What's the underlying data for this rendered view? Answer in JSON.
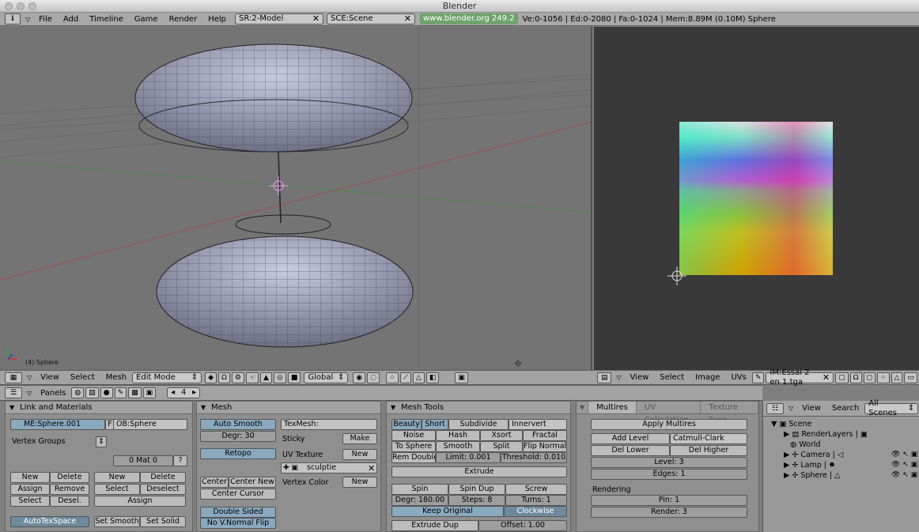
{
  "window": {
    "title": "Blender"
  },
  "topbar": {
    "menus": [
      "File",
      "Add",
      "Timeline",
      "Game",
      "Render",
      "Help"
    ],
    "screen": "SR:2-Model",
    "scene": "SCE:Scene",
    "url": "www.blender.org 249.2",
    "stats": "Ve:0-1056 | Ed:0-2080 | Fa:0-1024 | Mem:8.89M (0.10M) Sphere"
  },
  "viewport3d": {
    "object_label": "(4) Sphere",
    "menus": [
      "View",
      "Select",
      "Mesh"
    ],
    "mode": "Edit Mode",
    "orientation": "Global"
  },
  "image_editor": {
    "menus": [
      "View",
      "Select",
      "Image",
      "UVs"
    ],
    "image_name": "IM:Essai 2 en 1.tga"
  },
  "buttons_header": {
    "label": "Panels",
    "frame": "4"
  },
  "link_materials": {
    "title": "Link and Materials",
    "mesh_name": "ME:Sphere.001",
    "f": "F",
    "object_name": "OB:Sphere",
    "vertex_groups": "Vertex Groups",
    "mat": "0 Mat 0",
    "q": "?",
    "new": "New",
    "delete": "Delete",
    "assign": "Assign",
    "remove": "Remove",
    "select": "Select",
    "desel": "Desel.",
    "new2": "New",
    "delete2": "Delete",
    "select2": "Select",
    "deselect": "Deselect",
    "assign2": "Assign",
    "autotexspace": "AutoTexSpace",
    "set_smooth": "Set Smooth",
    "set_solid": "Set Solid"
  },
  "mesh": {
    "title": "Mesh",
    "auto_smooth": "Auto Smooth",
    "degr": "Degr: 30",
    "retopo": "Retopo",
    "center": "Center",
    "center_new": "Center New",
    "center_cursor": "Center Cursor",
    "double_sided": "Double Sided",
    "no_vnormal_flip": "No V.Normal Flip",
    "texmesh": "TexMesh:",
    "sticky": "Sticky",
    "make": "Make",
    "uv_texture": "UV Texture",
    "new_uv": "New",
    "uv_name": "sculptie",
    "vertex_color": "Vertex Color",
    "new_vc": "New"
  },
  "mesh_tools": {
    "title": "Mesh Tools",
    "beauty": "Beauty",
    "short": "Short",
    "subdivide": "Subdivide",
    "innervert": "Innervert",
    "noise": "Noise",
    "hash": "Hash",
    "xsort": "Xsort",
    "fractal": "Fractal",
    "to_sphere": "To Sphere",
    "smooth": "Smooth",
    "split": "Split",
    "flip_normals": "Flip Normals",
    "rem_doubles": "Rem Doubles",
    "limit": "Limit: 0.001",
    "threshold": "Threshold: 0.010",
    "extrude": "Extrude",
    "spin": "Spin",
    "spin_dup": "Spin Dup",
    "screw": "Screw",
    "degr": "Degr: 180.00",
    "steps": "Steps: 8",
    "turns": "Turns: 1",
    "keep_original": "Keep Original",
    "clockwise": "Clockwise",
    "extrude_dup": "Extrude Dup",
    "offset": "Offset: 1.00"
  },
  "multires": {
    "tabs": [
      "Multires",
      "UV Calculation",
      "Texture Face"
    ],
    "apply": "Apply Multires",
    "add_level": "Add Level",
    "subdiv_type": "Catmull-Clark",
    "del_lower": "Del Lower",
    "del_higher": "Del Higher",
    "level": "Level: 3",
    "edges": "Edges: 1",
    "rendering": "Rendering",
    "pin": "Pin: 1",
    "render": "Render: 3"
  },
  "outliner": {
    "menus": [
      "View",
      "Search"
    ],
    "filter": "All Scenes",
    "items": [
      "Scene",
      "RenderLayers",
      "World",
      "Camera",
      "Lamp",
      "Sphere"
    ]
  },
  "colors": {
    "accent": "#6e8a9e",
    "url_bg": "#6ea36c",
    "viewport_bg": "#747474",
    "mesh": "#a7a9c4"
  }
}
